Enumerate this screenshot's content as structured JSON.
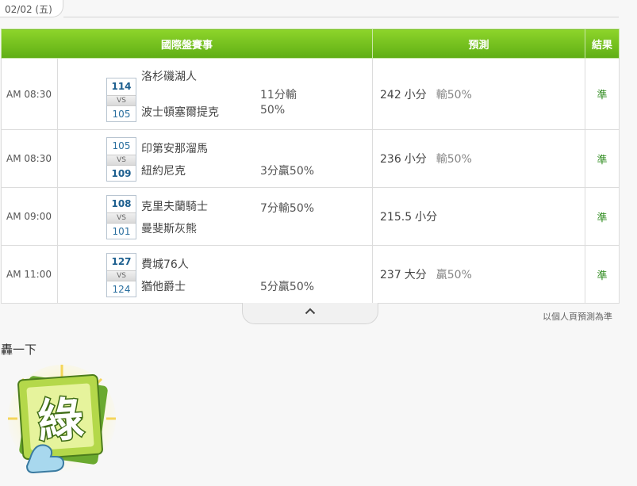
{
  "date_tab": "02/02 (五)",
  "table": {
    "headers": {
      "game": "國際盤賽事",
      "prediction": "預測",
      "result": "結果"
    },
    "rows": [
      {
        "time": "AM 08:30",
        "score_top": "114",
        "score_bottom": "105",
        "vs": "VS",
        "team_top": "洛杉磯湖人",
        "team_bottom": "波士頓塞爾提克",
        "spread_line1": "11分輸",
        "spread_line2": "50%",
        "total": "242",
        "total_unit": "小分",
        "total_odds": "輸50%",
        "result": "準"
      },
      {
        "time": "AM 08:30",
        "score_top": "105",
        "score_bottom": "109",
        "vs": "VS",
        "team_top": "印第安那溜馬",
        "team_bottom": "紐約尼克",
        "spread_line1": "",
        "spread_line2": "3分贏50%",
        "total": "236",
        "total_unit": "小分",
        "total_odds": "輸50%",
        "result": "準"
      },
      {
        "time": "AM 09:00",
        "score_top": "108",
        "score_bottom": "101",
        "vs": "VS",
        "team_top": "克里夫蘭騎士",
        "team_bottom": "曼斐斯灰熊",
        "spread_line1": "7分輸50%",
        "spread_line2": "",
        "total": "215.5",
        "total_unit": "小分",
        "total_odds": "",
        "result": "準"
      },
      {
        "time": "AM 11:00",
        "score_top": "127",
        "score_bottom": "124",
        "vs": "VS",
        "team_top": "費城76人",
        "team_bottom": "猶他爵士",
        "spread_line1": "",
        "spread_line2": "5分贏50%",
        "total": "237",
        "total_unit": "大分",
        "total_odds": "贏50%",
        "result": "準"
      }
    ]
  },
  "footnote": "以個人頁預測為準",
  "hong": {
    "title": "轟一下",
    "badge_char": "綠"
  },
  "colors": {
    "header_green_top": "#8dd42a",
    "header_green_bottom": "#5fae14",
    "result_green": "#2e8b1e",
    "score_blue": "#1d5f8f"
  }
}
